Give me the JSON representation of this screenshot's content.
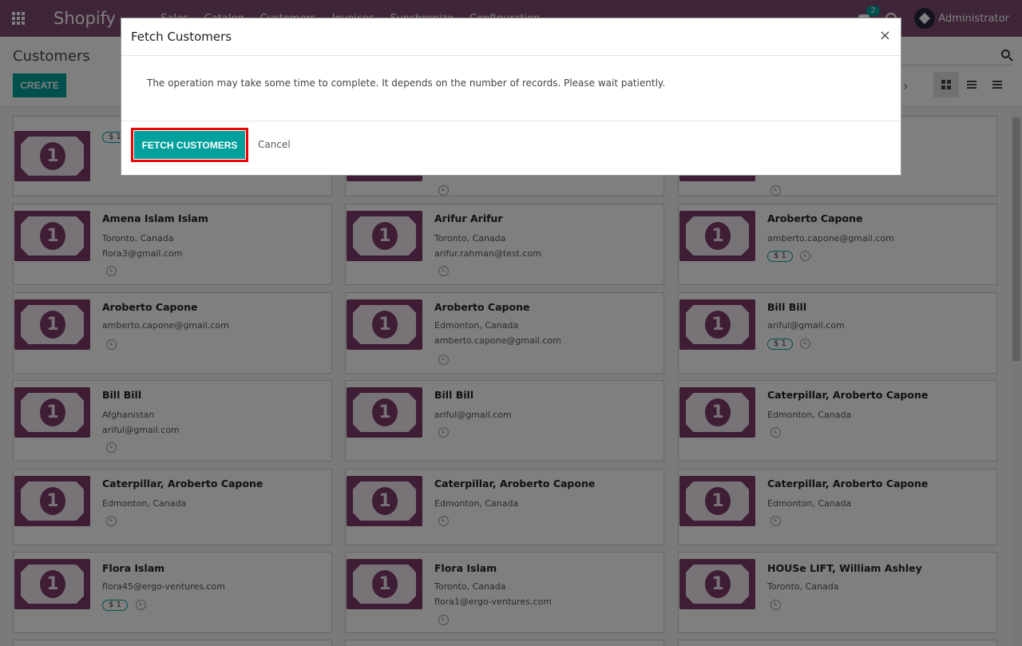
{
  "navbar": {
    "brand": "Shopify",
    "menu": [
      "Sales",
      "Catalog",
      "Customers",
      "Invoices",
      "Synchronize",
      "Configuration"
    ],
    "chat_count": "2",
    "user": "Administrator"
  },
  "control_panel": {
    "breadcrumb": "Customers",
    "create_label": "CREATE"
  },
  "cards": [
    {
      "title": "Amena Islam Islam",
      "line1": "Toronto, Canada",
      "line2": "flora3@gmail.com",
      "tag": ""
    },
    {
      "title": "Arifur Arifur",
      "line1": "Toronto, Canada",
      "line2": "arifur.rahman@test.com",
      "tag": ""
    },
    {
      "title": "Aroberto Capone",
      "line1": "amberto.capone@gmail.com",
      "line2": "",
      "tag": "$ 1"
    },
    {
      "title": "Aroberto Capone",
      "line1": "amberto.capone@gmail.com",
      "line2": "",
      "tag": ""
    },
    {
      "title": "Aroberto Capone",
      "line1": "Edmonton, Canada",
      "line2": "amberto.capone@gmail.com",
      "tag": ""
    },
    {
      "title": "Bill Bill",
      "line1": "ariful@gmail.com",
      "line2": "",
      "tag": "$ 1"
    },
    {
      "title": "Bill Bill",
      "line1": "Afghanistan",
      "line2": "ariful@gmail.com",
      "tag": ""
    },
    {
      "title": "Bill Bill",
      "line1": "ariful@gmail.com",
      "line2": "",
      "tag": ""
    },
    {
      "title": "Caterpillar, Aroberto Capone",
      "line1": "Edmonton, Canada",
      "line2": "",
      "tag": ""
    },
    {
      "title": "Caterpillar, Aroberto Capone",
      "line1": "Edmonton, Canada",
      "line2": "",
      "tag": ""
    },
    {
      "title": "Caterpillar, Aroberto Capone",
      "line1": "Edmonton, Canada",
      "line2": "",
      "tag": ""
    },
    {
      "title": "Caterpillar, Aroberto Capone",
      "line1": "Edmonton, Canada",
      "line2": "",
      "tag": ""
    },
    {
      "title": "Flora Islam",
      "line1": "flora45@ergo-ventures.com",
      "line2": "",
      "tag": "$ 1"
    },
    {
      "title": "Flora Islam",
      "line1": "Toronto, Canada",
      "line2": "flora1@ergo-ventures.com",
      "tag": ""
    },
    {
      "title": "HOUSe LIFT, William Ashley",
      "line1": "Toronto, Canada",
      "line2": "",
      "tag": ""
    }
  ],
  "top_row_tag": "$ 1",
  "card_image_digit": "1",
  "modal": {
    "title": "Fetch Customers",
    "close": "×",
    "message": "The operation may take some time to complete. It depends on the number of records. Please wait patiently.",
    "primary": "FETCH CUSTOMERS",
    "cancel": "Cancel"
  }
}
